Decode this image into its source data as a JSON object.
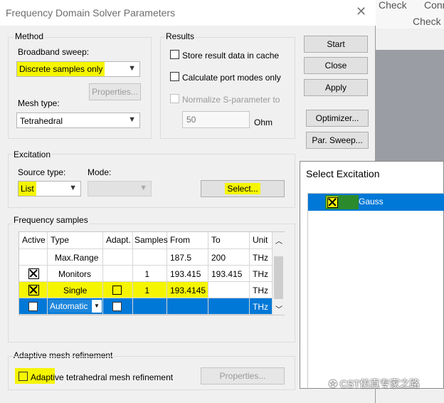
{
  "background": {
    "check_a": "Check",
    "conn": "Conn",
    "check_b": "Check"
  },
  "dialog": {
    "title": "Frequency Domain Solver Parameters",
    "method": {
      "label": "Method",
      "broadband_label": "Broadband sweep:",
      "broadband_value": "Discrete samples only",
      "properties": "Properties...",
      "mesh_label": "Mesh type:",
      "mesh_value": "Tetrahedral"
    },
    "results": {
      "label": "Results",
      "store_cache": "Store result data in cache",
      "port_modes": "Calculate port modes only",
      "normalize": "Normalize S-parameter to",
      "normalize_value": "50",
      "unit": "Ohm"
    },
    "buttons": {
      "start": "Start",
      "close": "Close",
      "apply": "Apply",
      "optimizer": "Optimizer...",
      "par_sweep": "Par. Sweep..."
    },
    "excitation": {
      "label": "Excitation",
      "source_label": "Source type:",
      "source_value": "List",
      "mode_label": "Mode:",
      "mode_value": "",
      "select": "Select..."
    },
    "freq": {
      "label": "Frequency samples",
      "headers": [
        "Active",
        "Type",
        "Adapt.",
        "Samples",
        "From",
        "To",
        "Unit"
      ],
      "rows": [
        {
          "type": "Max.Range",
          "samples": "",
          "from": "187.5",
          "to": "200",
          "unit": "THz"
        },
        {
          "type": "Monitors",
          "samples": "1",
          "from": "193.415",
          "to": "193.415",
          "unit": "THz"
        },
        {
          "type": "Single",
          "samples": "1",
          "from": "193.4145",
          "to": "",
          "unit": "THz"
        },
        {
          "type": "Automatic",
          "samples": "",
          "from": "",
          "to": "",
          "unit": "THz"
        }
      ]
    },
    "adaptive": {
      "label": "Adaptive mesh refinement",
      "checkbox": "Adaptive tetrahedral mesh refinement",
      "properties": "Properties..."
    }
  },
  "select_excitation": {
    "title": "Select Excitation",
    "item": "Gauss"
  },
  "watermark": "CST仿真专家之路",
  "colors": {
    "highlight": "#f5f500",
    "selection": "#0078d7",
    "green": "#2b8a2b"
  }
}
